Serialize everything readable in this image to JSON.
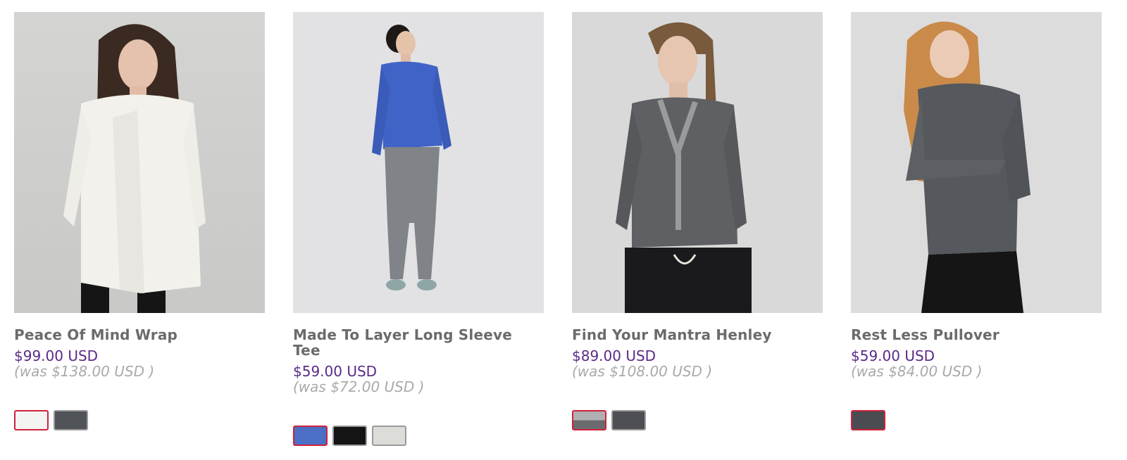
{
  "products": [
    {
      "name": "Peace Of Mind Wrap",
      "price": "$99.00 USD",
      "was": "(was $138.00 USD )",
      "swatches": [
        {
          "label": "white",
          "color": "#f4f4f2",
          "selected": true
        },
        {
          "label": "dark heather grey",
          "color": "#505358",
          "selected": false
        }
      ]
    },
    {
      "name": "Made To Layer Long Sleeve Tee",
      "price": "$59.00 USD",
      "was": "(was $72.00 USD )",
      "swatches": [
        {
          "label": "heathered blue",
          "color": "#4a6fc4",
          "selected": true
        },
        {
          "label": "black",
          "color": "#141414",
          "selected": false
        },
        {
          "label": "heathered light grey",
          "color": "#dcddd8",
          "selected": false
        }
      ]
    },
    {
      "name": "Find Your Mantra Henley",
      "price": "$89.00 USD",
      "was": "(was $108.00 USD )",
      "swatches": [
        {
          "label": "grey colorblock",
          "color": "#8e8e90",
          "selected": true
        },
        {
          "label": "dark grey",
          "color": "#4d4f54",
          "selected": false
        }
      ]
    },
    {
      "name": "Rest Less Pullover",
      "price": "$59.00 USD",
      "was": "(was $84.00 USD )",
      "swatches": [
        {
          "label": "heathered black",
          "color": "#4a4c52",
          "selected": true
        }
      ]
    }
  ],
  "colors": {
    "price": "#5a2a86",
    "was": "#a9a9a9",
    "name": "#6b6b6b",
    "selected_border": "#d0213c"
  }
}
